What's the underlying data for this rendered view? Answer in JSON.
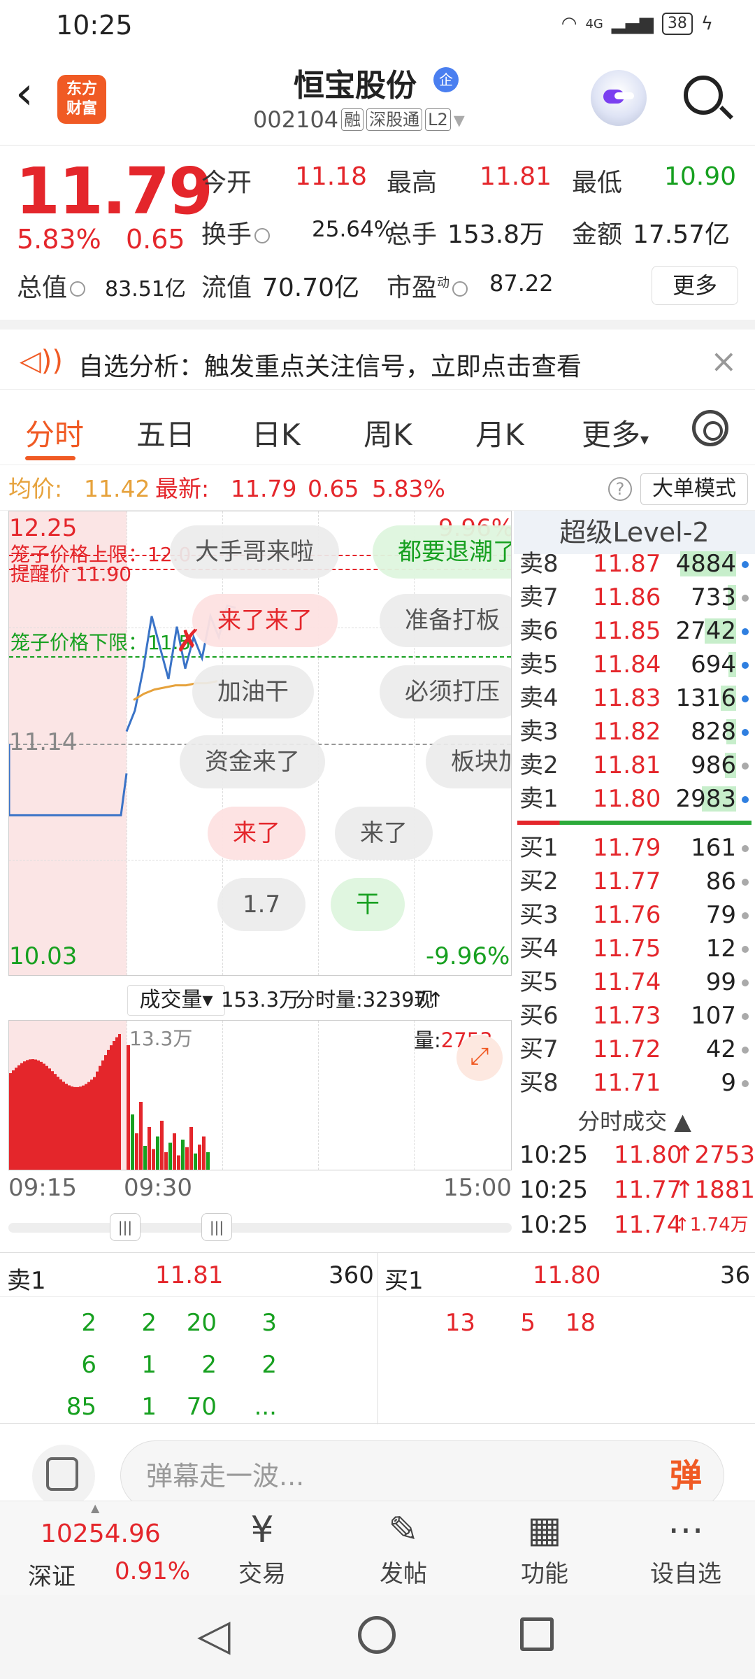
{
  "status_bar": {
    "time": "10:25",
    "network": "4G",
    "battery": "38"
  },
  "header": {
    "logo_line1": "东方",
    "logo_line2": "财富",
    "stock_name": "恒宝股份",
    "qi_badge": "企",
    "code": "002104",
    "tags": [
      "融",
      "深股通",
      "L2"
    ]
  },
  "quote": {
    "price": "11.79",
    "change_pct": "5.83%",
    "change": "0.65",
    "open_label": "今开",
    "open": "11.18",
    "high_label": "最高",
    "high": "11.81",
    "low_label": "最低",
    "low": "10.90",
    "turnover_label": "换手",
    "turnover": "25.64%",
    "volume_label": "总手",
    "volume": "153.8万",
    "amount_label": "金额",
    "amount": "17.57亿",
    "mktcap_label": "总值",
    "mktcap": "83.51亿",
    "float_label": "流值",
    "float": "70.70亿",
    "pe_label": "市盈",
    "pe_sup": "动",
    "pe": "87.22",
    "more": "更多"
  },
  "alert": {
    "text": "自选分析：触发重点关注信号，立即点击查看"
  },
  "tabs": [
    {
      "label": "分时",
      "active": true
    },
    {
      "label": "五日"
    },
    {
      "label": "日K"
    },
    {
      "label": "周K"
    },
    {
      "label": "月K"
    },
    {
      "label": "更多"
    }
  ],
  "avg_bar": {
    "avg_label": "均价:",
    "avg": "11.42",
    "latest_label": "最新:",
    "latest": "11.79",
    "chg": "0.65",
    "pct": "5.83%",
    "help": "?",
    "big_order_mode": "大单模式"
  },
  "chart": {
    "y_top": "12.25",
    "y_mid": "11.14",
    "y_bottom": "10.03",
    "pct_top": "9.96%",
    "pct_bottom": "-9.96%",
    "cage_upper": "笼子价格上限：12.0",
    "alert_price": "提醒价 11.90",
    "cage_lower": "笼子价格下限：11.5",
    "bubbles": [
      "大手哥来啦",
      "都要退潮了",
      "来了来了",
      "准备打板",
      "加油干",
      "必须打压",
      "资金来了",
      "板块加",
      "来了",
      "来了",
      "1.7",
      "干"
    ]
  },
  "chart_data": {
    "type": "line",
    "title": "",
    "ylim": [
      10.03,
      12.25
    ],
    "x_ticks": [
      "09:15",
      "09:30",
      "15:00"
    ],
    "series": [
      {
        "name": "price",
        "values": [
          11.14,
          11.14,
          11.14,
          11.14,
          11.14,
          11.2,
          11.3,
          11.5,
          11.75,
          11.6,
          11.45,
          11.7,
          11.5,
          11.65,
          11.55,
          11.75,
          11.65,
          11.8,
          11.79
        ]
      },
      {
        "name": "avg",
        "values": [
          11.35,
          11.38,
          11.4,
          11.41,
          11.42,
          11.42,
          11.43,
          11.43,
          11.44
        ]
      }
    ],
    "volume_max_label": "13.3万"
  },
  "volume": {
    "selector": "成交量",
    "total": "153.3万",
    "tick_vol": "分时量:32397↑",
    "now_vol_label": "现量:",
    "now_vol": "2753"
  },
  "time_axis": {
    "start": "09:15",
    "open": "09:30",
    "end": "15:00"
  },
  "level2": {
    "title": "超级Level-2",
    "asks": [
      {
        "side": "卖8",
        "price": "11.87",
        "vol": "4884"
      },
      {
        "side": "卖7",
        "price": "11.86",
        "vol": "733"
      },
      {
        "side": "卖6",
        "price": "11.85",
        "vol": "2742"
      },
      {
        "side": "卖5",
        "price": "11.84",
        "vol": "694"
      },
      {
        "side": "卖4",
        "price": "11.83",
        "vol": "1316"
      },
      {
        "side": "卖3",
        "price": "11.82",
        "vol": "828"
      },
      {
        "side": "卖2",
        "price": "11.81",
        "vol": "986"
      },
      {
        "side": "卖1",
        "price": "11.80",
        "vol": "2983"
      }
    ],
    "bids": [
      {
        "side": "买1",
        "price": "11.79",
        "vol": "161"
      },
      {
        "side": "买2",
        "price": "11.77",
        "vol": "86"
      },
      {
        "side": "买3",
        "price": "11.76",
        "vol": "79"
      },
      {
        "side": "买4",
        "price": "11.75",
        "vol": "12"
      },
      {
        "side": "买5",
        "price": "11.74",
        "vol": "99"
      },
      {
        "side": "买6",
        "price": "11.73",
        "vol": "107"
      },
      {
        "side": "买7",
        "price": "11.72",
        "vol": "42"
      },
      {
        "side": "买8",
        "price": "11.71",
        "vol": "9"
      }
    ],
    "trades_title": "分时成交",
    "trades": [
      {
        "time": "10:25",
        "price": "11.80",
        "vol": "↑2753"
      },
      {
        "time": "10:25",
        "price": "11.77",
        "vol": "↑1881"
      },
      {
        "time": "10:25",
        "price": "11.74",
        "vol": "↑1.74万"
      }
    ]
  },
  "detail": {
    "sell_label": "卖1",
    "sell_price": "11.81",
    "sell_total": "360",
    "buy_label": "买1",
    "buy_price": "11.80",
    "buy_total": "36",
    "sell_rows": [
      [
        "2",
        "2",
        "20",
        "3"
      ],
      [
        "6",
        "1",
        "2",
        "2"
      ],
      [
        "85",
        "1",
        "70",
        "..."
      ]
    ],
    "buy_rows": [
      [
        "13",
        "5",
        "18"
      ]
    ]
  },
  "danmaku": {
    "placeholder": "弹幕走一波...",
    "send": "弹"
  },
  "bottom_nav": {
    "index_value": "10254.96",
    "index_name": "深证",
    "index_pct": "0.91%",
    "items": [
      "交易",
      "发帖",
      "功能",
      "设自选"
    ]
  }
}
